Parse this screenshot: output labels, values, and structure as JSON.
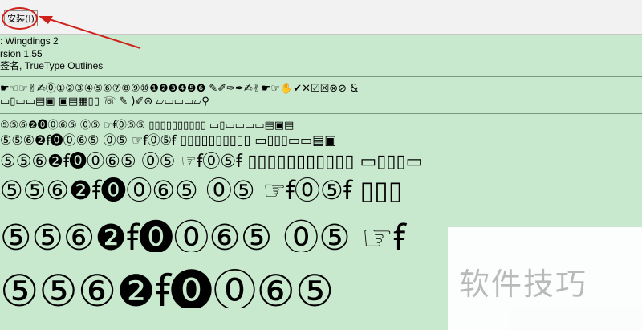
{
  "toolbar": {
    "install_label": "安装(I)"
  },
  "font_info": {
    "name_line": ": Wingdings 2",
    "version_line": "rsion 1.55",
    "type_line": "签名, TrueType Outlines"
  },
  "sample_rows": [
    "☛☜☞✌✍⓪①②③④⑤⑥⑦⑧⑨⑩❶❷❸❹❺❻   ✎✐✑✒✍✌☛☞✋✔✕☑☒⊗⊘ &",
    "▭▯▭▭▤▣ ▣▤▦▯▯   ☏  ✎  )✐⊛ ▱▭▭▭▱⚲",
    "⑤⑤⑥❷⓿⓪⑥⑤  ⓪⑤  ☞ꞙ⓪⑤⑤  ▯▯▯▯▯▯▯▯▯▯  ▭▯▭▭▭▭▤▣▤",
    "⑤⑤⑥❷ꞙ⓿⓪⑥⑤   ⓪⑤   ☞ꞙ⓪⑤ꞙ  ▯▯▯▯▯▯▯▯▯▯  ▭▯▯▯▭▭▤▣",
    "⑤⑤⑥❷ꞙ⓿⓪⑥⑤   ⓪⑤   ☞ꞙ⓪⑤ꞙ   ▯▯▯▯▯▯▯▯▯▯▯  ▭▯▯▯▭",
    "⑤⑤⑥❷ꞙ⓿⓪⑥⑤   ⓪⑤   ☞ꞙ⓪⑤ꞙ  ▯▯▯",
    "⑤⑤⑥❷ꞙ⓿⓪⑥⑤   ⓪⑤   ☞ꞙ",
    "⑤⑤⑥❷ꞙ⓿⓪⑥⑤"
  ],
  "watermark": {
    "text": "软件技巧"
  }
}
